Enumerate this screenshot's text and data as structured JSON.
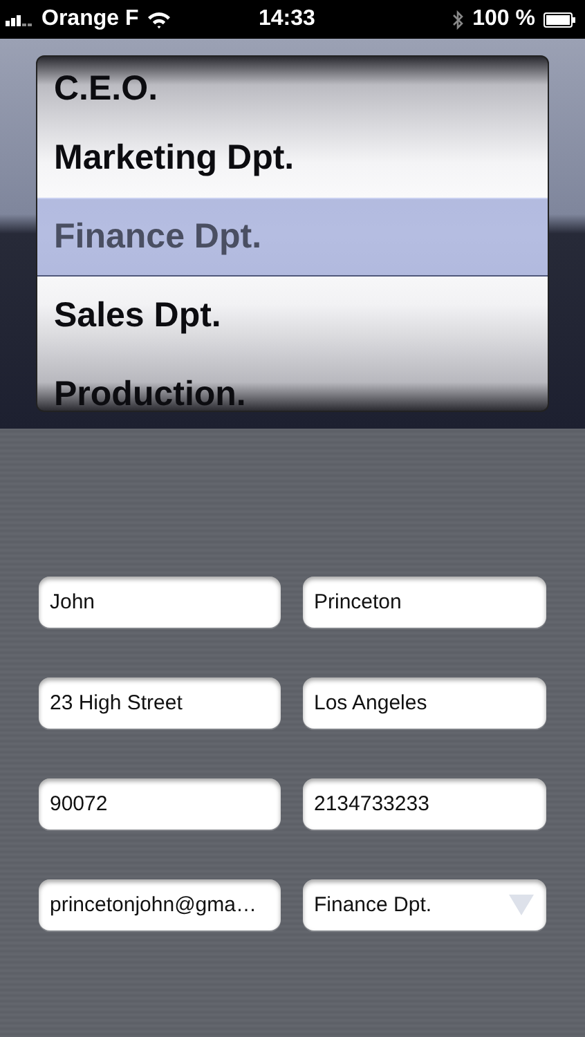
{
  "status_bar": {
    "carrier": "Orange F",
    "time": "14:33",
    "battery": "100 %"
  },
  "picker": {
    "items": [
      {
        "label": "C.E.O.",
        "selected": false
      },
      {
        "label": "Marketing Dpt.",
        "selected": false
      },
      {
        "label": "Finance Dpt.",
        "selected": true
      },
      {
        "label": "Sales Dpt.",
        "selected": false
      },
      {
        "label": "Production.",
        "selected": false
      }
    ]
  },
  "form": {
    "fields": [
      {
        "kind": "text",
        "value": "John"
      },
      {
        "kind": "text",
        "value": "Princeton"
      },
      {
        "kind": "text",
        "value": "23 High Street"
      },
      {
        "kind": "text",
        "value": "Los Angeles"
      },
      {
        "kind": "text",
        "value": "90072"
      },
      {
        "kind": "text",
        "value": "2134733233"
      },
      {
        "kind": "text",
        "value": "princetonjohn@gma…"
      },
      {
        "kind": "dropdown",
        "value": "Finance Dpt."
      }
    ]
  }
}
